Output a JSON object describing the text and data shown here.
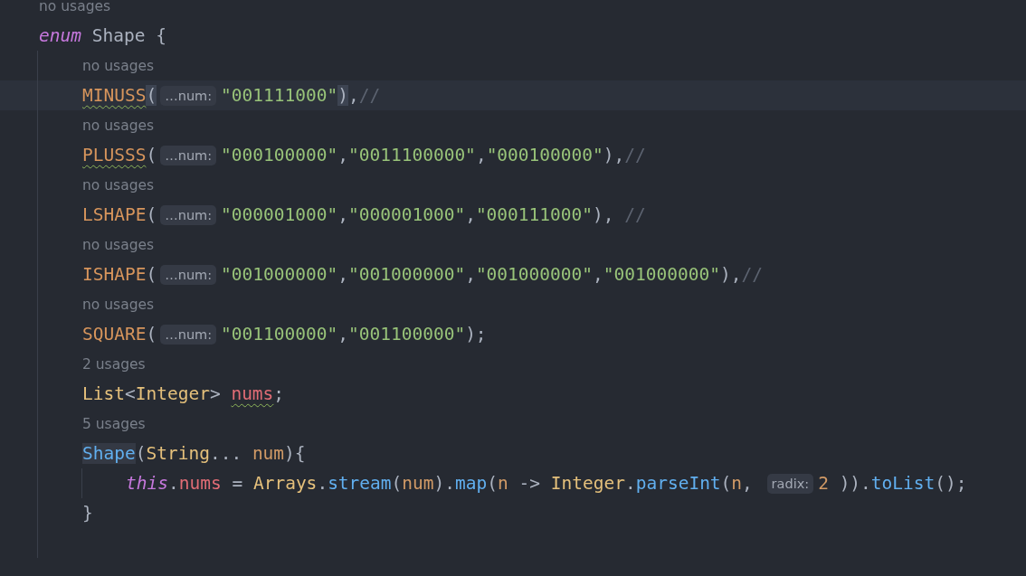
{
  "lines": [
    {
      "kind": "hint",
      "text": "no usages"
    },
    {
      "kind": "code",
      "tokens": [
        {
          "kind": "keyword",
          "text": "enum"
        },
        {
          "kind": "plain",
          "text": " Shape {"
        }
      ],
      "children": [
        {
          "kind": "hint",
          "text": "no usages"
        },
        {
          "kind": "current_code",
          "tokens": [
            {
              "kind": "const_warn",
              "text": "MINUSS"
            },
            {
              "kind": "match",
              "text": "("
            },
            {
              "kind": "inlay",
              "text": "…num:"
            },
            {
              "kind": "string",
              "text": "\"001111000\""
            },
            {
              "kind": "match",
              "text": ")"
            },
            {
              "kind": "plain",
              "text": ","
            },
            {
              "kind": "comment",
              "text": "//"
            }
          ]
        },
        {
          "kind": "hint",
          "text": "no usages"
        },
        {
          "kind": "code",
          "tokens": [
            {
              "kind": "const_warn",
              "text": "PLUSSS"
            },
            {
              "kind": "plain",
              "text": "("
            },
            {
              "kind": "inlay",
              "text": "…num:"
            },
            {
              "kind": "string",
              "text": "\"000100000\""
            },
            {
              "kind": "plain",
              "text": ","
            },
            {
              "kind": "string",
              "text": "\"0011100000\""
            },
            {
              "kind": "plain",
              "text": ","
            },
            {
              "kind": "string",
              "text": "\"000100000\""
            },
            {
              "kind": "plain",
              "text": "),"
            },
            {
              "kind": "comment",
              "text": "//"
            }
          ]
        },
        {
          "kind": "hint",
          "text": "no usages"
        },
        {
          "kind": "code",
          "tokens": [
            {
              "kind": "const",
              "text": "LSHAPE"
            },
            {
              "kind": "plain",
              "text": "("
            },
            {
              "kind": "inlay",
              "text": "…num:"
            },
            {
              "kind": "string",
              "text": "\"000001000\""
            },
            {
              "kind": "plain",
              "text": ","
            },
            {
              "kind": "string",
              "text": "\"000001000\""
            },
            {
              "kind": "plain",
              "text": ","
            },
            {
              "kind": "string",
              "text": "\"000111000\""
            },
            {
              "kind": "plain",
              "text": "), "
            },
            {
              "kind": "comment",
              "text": "//"
            }
          ]
        },
        {
          "kind": "hint",
          "text": "no usages"
        },
        {
          "kind": "code",
          "tokens": [
            {
              "kind": "const",
              "text": "ISHAPE"
            },
            {
              "kind": "plain",
              "text": "("
            },
            {
              "kind": "inlay",
              "text": "…num:"
            },
            {
              "kind": "string",
              "text": "\"001000000\""
            },
            {
              "kind": "plain",
              "text": ","
            },
            {
              "kind": "string",
              "text": "\"001000000\""
            },
            {
              "kind": "plain",
              "text": ","
            },
            {
              "kind": "string",
              "text": "\"001000000\""
            },
            {
              "kind": "plain",
              "text": ","
            },
            {
              "kind": "string",
              "text": "\"001000000\""
            },
            {
              "kind": "plain",
              "text": "),"
            },
            {
              "kind": "comment",
              "text": "//"
            }
          ]
        },
        {
          "kind": "hint",
          "text": "no usages"
        },
        {
          "kind": "code",
          "tokens": [
            {
              "kind": "const",
              "text": "SQUARE"
            },
            {
              "kind": "plain",
              "text": "("
            },
            {
              "kind": "inlay",
              "text": "…num:"
            },
            {
              "kind": "string",
              "text": "\"001100000\""
            },
            {
              "kind": "plain",
              "text": ","
            },
            {
              "kind": "string",
              "text": "\"001100000\""
            },
            {
              "kind": "plain",
              "text": ");"
            }
          ]
        },
        {
          "kind": "hint",
          "text": "2 usages"
        },
        {
          "kind": "code",
          "tokens": [
            {
              "kind": "type",
              "text": "List"
            },
            {
              "kind": "plain",
              "text": "<"
            },
            {
              "kind": "type",
              "text": "Integer"
            },
            {
              "kind": "plain",
              "text": "> "
            },
            {
              "kind": "field_warn",
              "text": "nums"
            },
            {
              "kind": "plain",
              "text": ";"
            }
          ]
        },
        {
          "kind": "hint",
          "text": "5 usages"
        },
        {
          "kind": "code",
          "tokens": [
            {
              "kind": "method_hl",
              "text": "Shape"
            },
            {
              "kind": "plain",
              "text": "("
            },
            {
              "kind": "type",
              "text": "String"
            },
            {
              "kind": "plain",
              "text": "... "
            },
            {
              "kind": "param",
              "text": "num"
            },
            {
              "kind": "plain",
              "text": "){"
            }
          ],
          "children": [
            {
              "kind": "code",
              "tokens": [
                {
                  "kind": "keyword",
                  "text": "this"
                },
                {
                  "kind": "plain",
                  "text": "."
                },
                {
                  "kind": "field",
                  "text": "nums"
                },
                {
                  "kind": "plain",
                  "text": " = "
                },
                {
                  "kind": "type",
                  "text": "Arrays"
                },
                {
                  "kind": "plain",
                  "text": "."
                },
                {
                  "kind": "method",
                  "text": "stream"
                },
                {
                  "kind": "plain",
                  "text": "("
                },
                {
                  "kind": "param",
                  "text": "num"
                },
                {
                  "kind": "plain",
                  "text": ")."
                },
                {
                  "kind": "method",
                  "text": "map"
                },
                {
                  "kind": "plain",
                  "text": "("
                },
                {
                  "kind": "param",
                  "text": "n"
                },
                {
                  "kind": "plain",
                  "text": " -> "
                },
                {
                  "kind": "type",
                  "text": "Integer"
                },
                {
                  "kind": "plain",
                  "text": "."
                },
                {
                  "kind": "method",
                  "text": "parseInt"
                },
                {
                  "kind": "plain",
                  "text": "("
                },
                {
                  "kind": "param",
                  "text": "n"
                },
                {
                  "kind": "plain",
                  "text": ", "
                },
                {
                  "kind": "inlay",
                  "text": "radix:"
                },
                {
                  "kind": "number",
                  "text": "2"
                },
                {
                  "kind": "plain",
                  "text": " ))."
                },
                {
                  "kind": "method",
                  "text": "toList"
                },
                {
                  "kind": "plain",
                  "text": "();"
                }
              ]
            }
          ]
        },
        {
          "kind": "code",
          "tokens": [
            {
              "kind": "plain",
              "text": "}"
            }
          ]
        },
        {
          "kind": "blank"
        }
      ]
    }
  ]
}
